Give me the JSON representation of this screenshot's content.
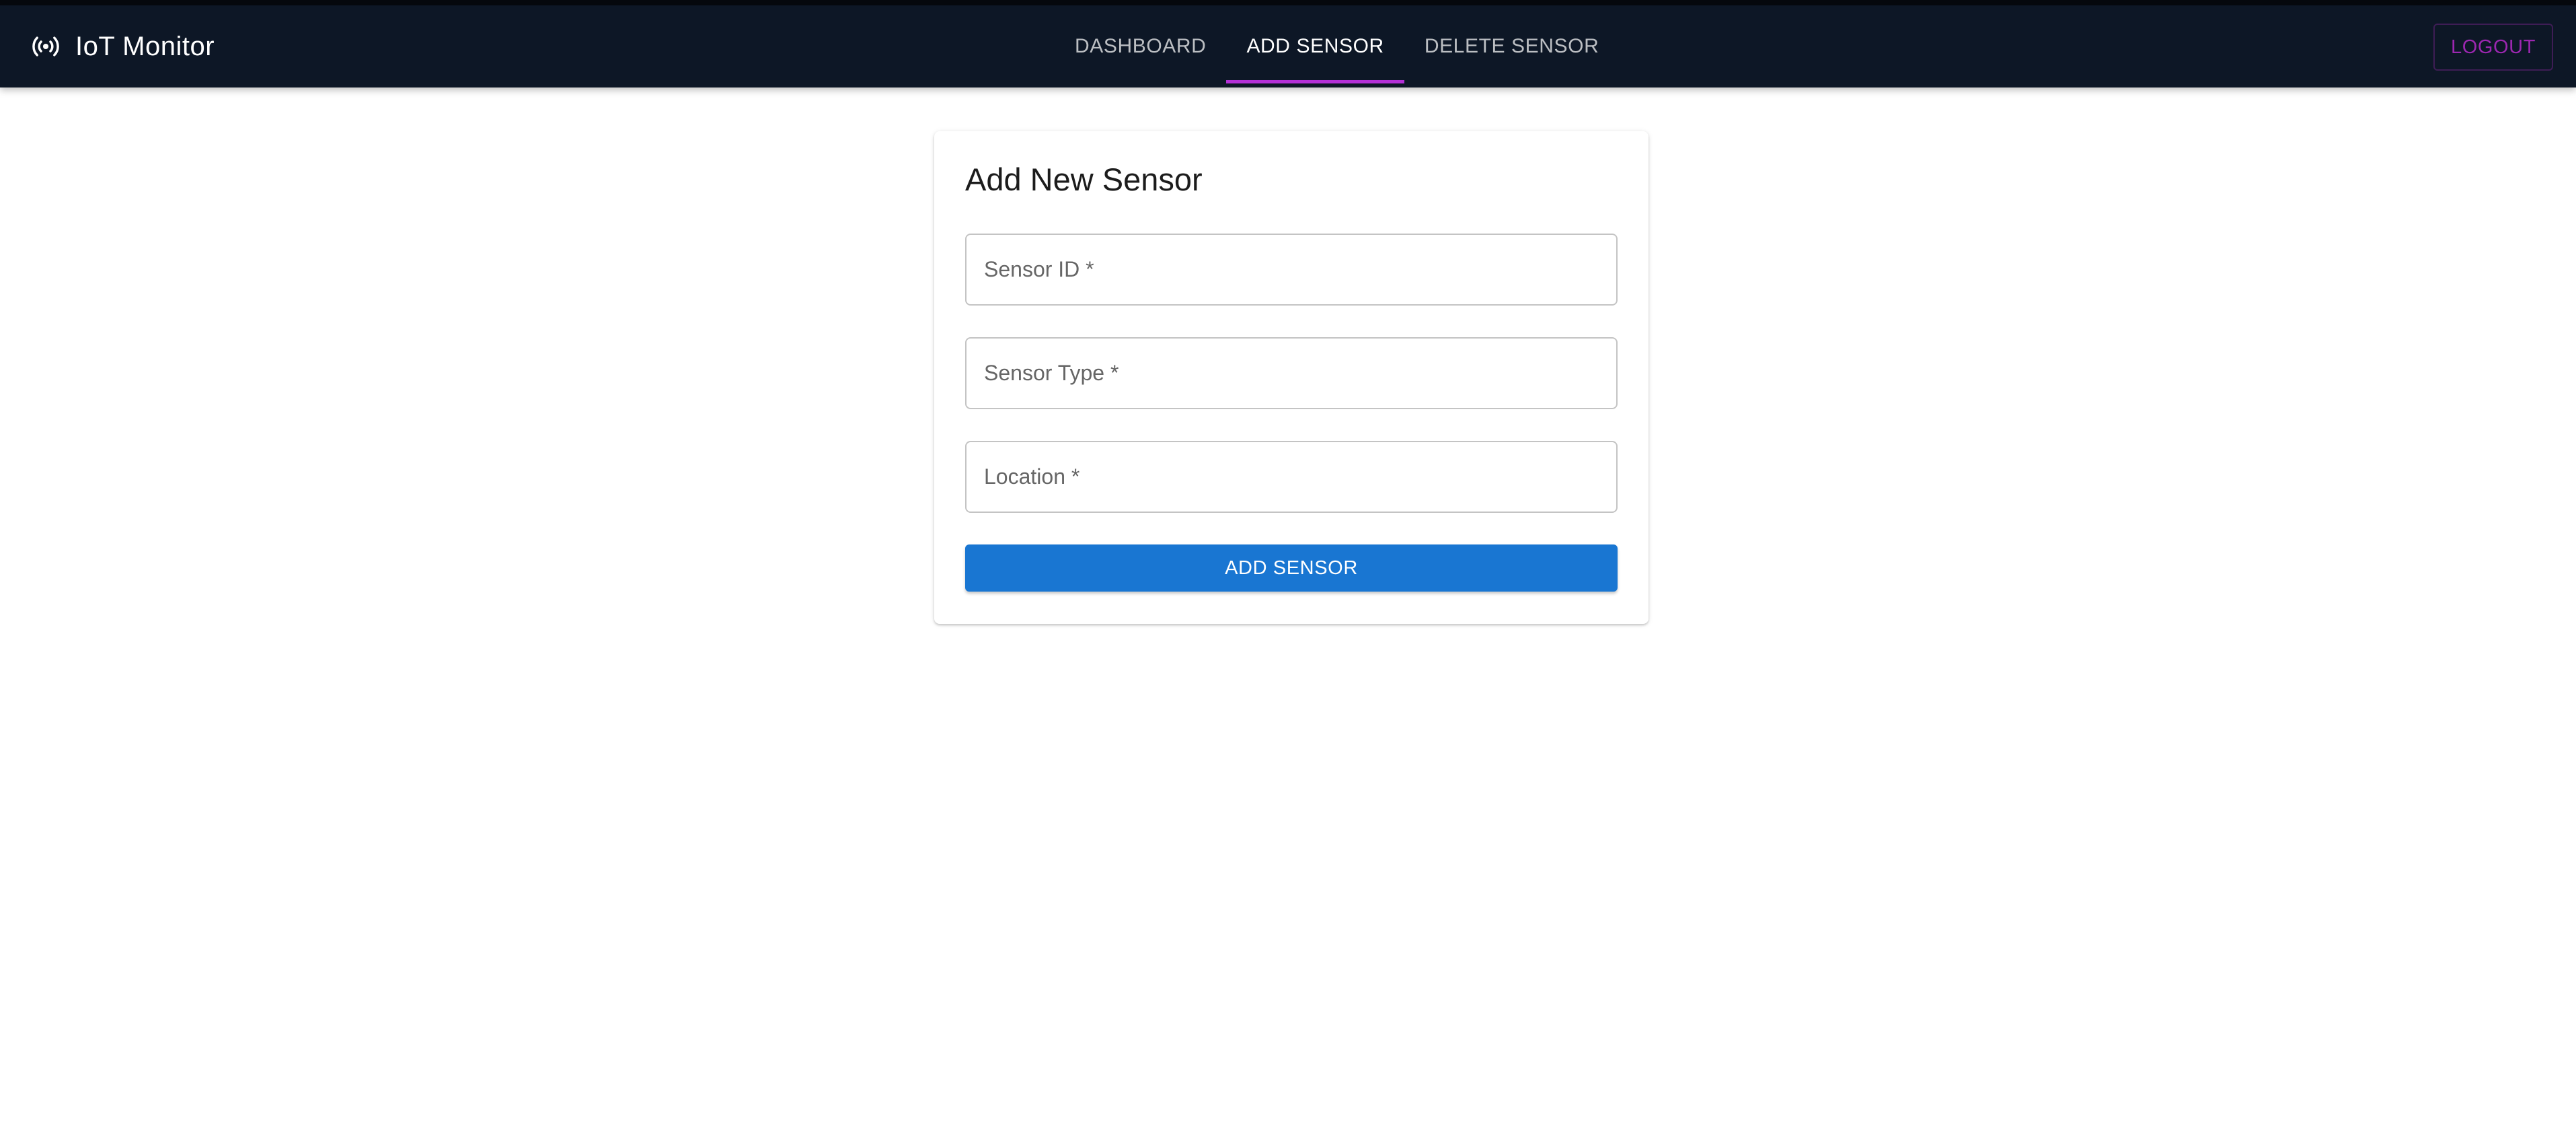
{
  "app": {
    "title": "IoT Monitor",
    "icon": "broadcast-icon"
  },
  "nav": {
    "tabs": [
      {
        "label": "DASHBOARD",
        "active": false
      },
      {
        "label": "ADD SENSOR",
        "active": true
      },
      {
        "label": "DELETE SENSOR",
        "active": false
      }
    ],
    "logout_label": "LOGOUT"
  },
  "form": {
    "title": "Add New Sensor",
    "fields": [
      {
        "placeholder": "Sensor ID *",
        "value": ""
      },
      {
        "placeholder": "Sensor Type *",
        "value": ""
      },
      {
        "placeholder": "Location *",
        "value": ""
      }
    ],
    "submit_label": "ADD SENSOR"
  },
  "colors": {
    "topbar_bg": "#0d1726",
    "active_tab_indicator": "#b32fd6",
    "logout_text": "#9c27b0",
    "primary_button": "#1976d2"
  }
}
